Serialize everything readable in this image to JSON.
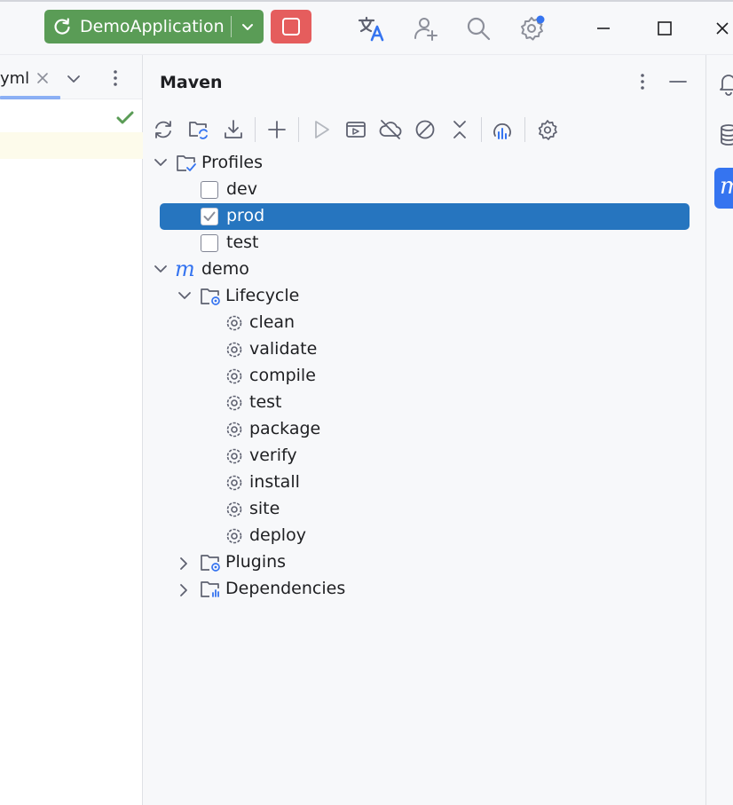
{
  "titlebar": {
    "run_config": "DemoApplication"
  },
  "editor": {
    "tab_label": "yml"
  },
  "maven": {
    "title": "Maven",
    "tree": {
      "profiles": {
        "label": "Profiles",
        "items": [
          {
            "label": "dev",
            "checked": false,
            "selected": false
          },
          {
            "label": "prod",
            "checked": true,
            "selected": true
          },
          {
            "label": "test",
            "checked": false,
            "selected": false
          }
        ]
      },
      "project": {
        "label": "demo",
        "lifecycle": {
          "label": "Lifecycle",
          "goals": [
            "clean",
            "validate",
            "compile",
            "test",
            "package",
            "verify",
            "install",
            "site",
            "deploy"
          ]
        },
        "plugins": {
          "label": "Plugins"
        },
        "dependencies": {
          "label": "Dependencies"
        }
      }
    }
  },
  "colors": {
    "run_green": "#5a9c56",
    "stop_red": "#e55d5d",
    "selection": "#2675bf",
    "accent": "#3574f0"
  },
  "icons": [
    "reload-icon",
    "chevron-down-icon",
    "stop-icon",
    "translate-icon",
    "add-user-icon",
    "search-icon",
    "settings-icon",
    "minimize-window-icon",
    "maximize-window-icon",
    "close-window-icon",
    "close-icon",
    "kebab-icon",
    "checkmark-icon",
    "reload-all-icon",
    "generate-sources-icon",
    "download-icon",
    "add-icon",
    "run-icon",
    "execute-goal-icon",
    "offline-icon",
    "skip-tests-icon",
    "collapse-icon",
    "analyze-icon",
    "gear-icon",
    "folder-icon",
    "maven-icon",
    "notifications-icon",
    "database-icon"
  ]
}
